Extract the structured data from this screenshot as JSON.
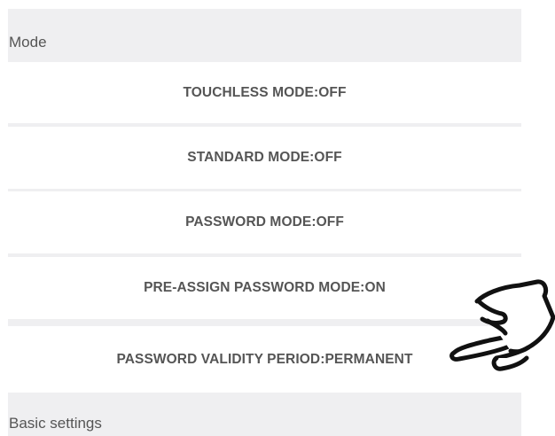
{
  "sections": {
    "mode_title": "Mode",
    "basic_title": "Basic settings"
  },
  "mode_items": [
    {
      "label": "TOUCHLESS MODE:OFF"
    },
    {
      "label": "STANDARD MODE:OFF"
    },
    {
      "label": "PASSWORD MODE:OFF"
    },
    {
      "label": "PRE-ASSIGN PASSWORD MODE:ON"
    },
    {
      "label": "PASSWORD VALIDITY PERIOD:PERMANENT"
    }
  ],
  "overlay": {
    "pointer_icon": "pointing-hand-icon"
  }
}
